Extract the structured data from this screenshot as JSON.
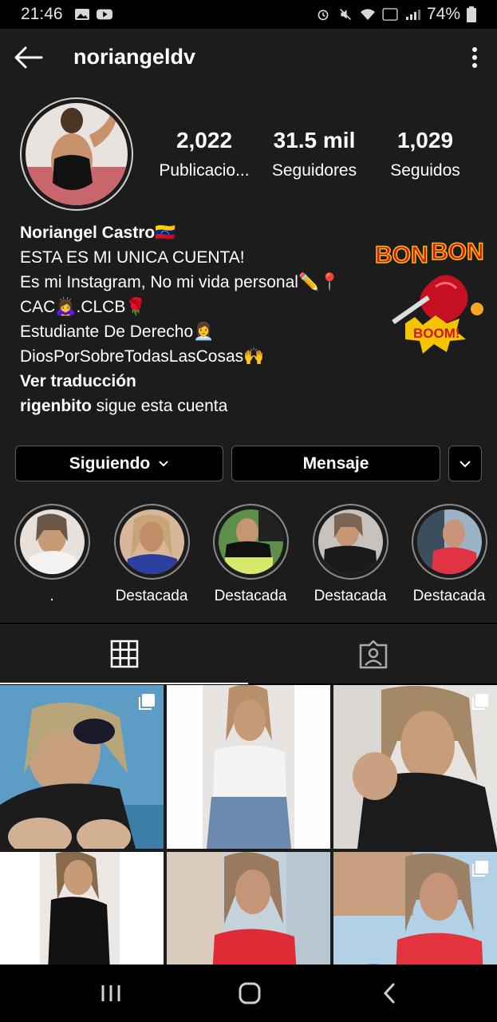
{
  "status_bar": {
    "time": "21:46",
    "battery": "74%"
  },
  "header": {
    "username": "noriangeldv"
  },
  "profile": {
    "stats": [
      {
        "value": "2,022",
        "label": "Publicacio..."
      },
      {
        "value": "31.5 mil",
        "label": "Seguidores"
      },
      {
        "value": "1,029",
        "label": "Seguidos"
      }
    ],
    "bio": {
      "name": "Noriangel Castro🇻🇪",
      "lines": [
        "ESTA ES MI UNICA CUENTA!",
        "Es mi Instagram, No mi vida personal✏️📍",
        "CAC🙇‍♀️.CLCB🌹",
        "Estudiante De Derecho👩‍💼",
        "DiosPorSobreTodasLasCosas🙌"
      ],
      "translate": "Ver traducción",
      "followed_by_name": "rigenbito",
      "followed_by_text": " sigue esta cuenta"
    },
    "sticker": {
      "word1": "BON",
      "word2": "BON",
      "boom": "BOOM!"
    }
  },
  "actions": {
    "following": "Siguiendo",
    "message": "Mensaje"
  },
  "highlights": [
    {
      "label": "."
    },
    {
      "label": "Destacada"
    },
    {
      "label": "Destacada"
    },
    {
      "label": "Destacada"
    },
    {
      "label": "Destacada"
    }
  ],
  "colors": {
    "background": "#1c1c1c",
    "text": "#ffffff",
    "border": "#5a5a5a",
    "sticker_red": "#d4122a",
    "sticker_yellow": "#f5c400"
  }
}
